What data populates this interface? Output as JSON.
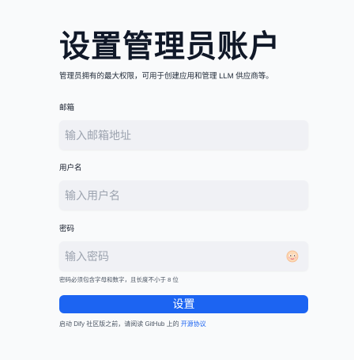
{
  "page": {
    "title": "设置管理员账户",
    "subtitle": "管理员拥有的最大权限，可用于创建应用和管理 LLM 供应商等。"
  },
  "form": {
    "email": {
      "label": "邮箱",
      "placeholder": "输入邮箱地址",
      "value": ""
    },
    "username": {
      "label": "用户名",
      "placeholder": "输入用户名",
      "value": ""
    },
    "password": {
      "label": "密码",
      "placeholder": "输入密码",
      "value": "",
      "toggle_icon": "eye-emoji-icon",
      "hint": "密码必须包含字母和数字，且长度不小于 8 位"
    },
    "submit_label": "设置"
  },
  "footer": {
    "agreement_prefix": "启动 Dify 社区版之前，请阅读 GitHub 上的 ",
    "agreement_link": "开源协议"
  },
  "colors": {
    "accent": "#1c64f2",
    "input_bg": "#f0f1f5",
    "page_bg": "#f9fafb"
  }
}
